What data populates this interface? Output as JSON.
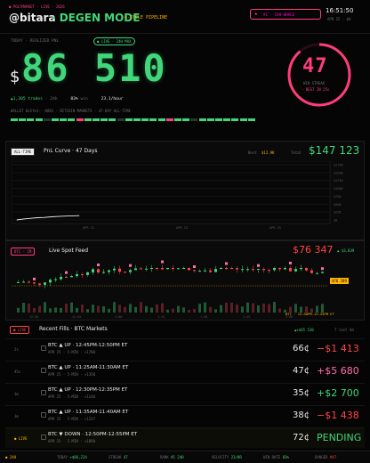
{
  "topbar": {
    "brand_tag": "● POLYMARKET · LIVE · 2026",
    "handle": "@bitara",
    "mode": "· DEGEN MODE",
    "pipeline": "6-CYCLE PIPELINE",
    "rank_badge": "#1 · 24H WHALE",
    "clock": "16:51:50",
    "date": "APR 25 · 04"
  },
  "hero": {
    "label": "TODAY · REALIZED PNL",
    "live_badge": "● LIVE · 24H MAX",
    "currency": "$",
    "amount": "86 510",
    "trades": "▲1,305 trades",
    "window": "24h",
    "win_rate": "83%",
    "win_label": "win",
    "rate": "23.1/hour",
    "wallet": "WALLET  0x5fe1···0881 · BITCOIN MARKETS · 47-DAY ALL-TIME",
    "streak_num": "47",
    "streak_label": "WIN STREAK",
    "streak_sub": "· BEST IN 25s"
  },
  "pnl_curve": {
    "tab": "ALL-TIME",
    "title": "PnL Curve · 47 Days",
    "best_label": "Best",
    "best_value": "$12.9K",
    "total_label": "Total",
    "total_value": "$147 123",
    "y_ticks": [
      "$175K",
      "$150K",
      "$125K",
      "$100K",
      "$75K",
      "$50K",
      "$25K",
      "$0"
    ],
    "x_ticks": [
      "APR 22",
      "APR 23",
      "APR 25"
    ]
  },
  "chart_data": {
    "type": "line",
    "title": "PnL Curve · 47 Days",
    "x": [
      0,
      1,
      2,
      3,
      4,
      5,
      6,
      7,
      8,
      9
    ],
    "values": [
      0,
      3,
      5,
      7,
      8,
      10,
      11,
      12,
      13,
      13.5
    ],
    "ylim": [
      0,
      175
    ]
  },
  "spot": {
    "tab": "BTC · 1M",
    "title": "Live Spot Feed",
    "price": "$76 347",
    "delta": "▲ $3,839",
    "last_tag": "$76 289",
    "x_ticks": [
      "12:30",
      "12:45",
      "1:00",
      "1:15",
      "1:30",
      "1:45",
      "2:00"
    ],
    "window_label": "BTC · 12:50PM-12:55PM ET",
    "y_ticks": [
      "$76.4K",
      "$76.3K",
      "$76.2K",
      "$76.1K",
      "$76.0K"
    ]
  },
  "fills": {
    "tab": "● LIVE",
    "title": "Recent Fills · BTC Markets",
    "summary": "▲+$45 510",
    "summary2": "7 last 4d",
    "rows": [
      {
        "age": "2s",
        "title": "BTC ▲ UP · 12:45PM-12:50PM ET",
        "sub": "APR 25 · 5-MIN · ×1700",
        "price": "66¢",
        "pnl": "−$1 413",
        "color": "red",
        "live": false
      },
      {
        "age": "45s",
        "title": "BTC ▲ UP · 11:25AM-11:30AM ET",
        "sub": "APR 25 · 5-MIN · ×1350",
        "price": "47¢",
        "pnl": "+$5 680",
        "color": "pink",
        "live": false
      },
      {
        "age": "1m",
        "title": "BTC ▲ UP · 12:30PM-12:35PM ET",
        "sub": "APR 25 · 5-MIN · ×1240",
        "price": "35¢",
        "pnl": "+$2 700",
        "color": "green",
        "live": false
      },
      {
        "age": "1m",
        "title": "BTC ▲ UP · 11:35AM-11:40AM ET",
        "sub": "APR 25 · 5-MIN · ×1237",
        "price": "38¢",
        "pnl": "−$1 438",
        "color": "red",
        "live": false
      },
      {
        "age": "● LIVE",
        "title": "BTC ▼ DOWN · 12:50PM-12:55PM ET",
        "sub": "APR 25 · 5-MIN · ×1890",
        "price": "72¢",
        "pnl": "PENDING",
        "color": "green",
        "live": true
      }
    ]
  },
  "footer": {
    "items": [
      {
        "k": "● 24H",
        "v": ""
      },
      {
        "k": "TODAY",
        "v": "+$86,224"
      },
      {
        "k": "STREAK",
        "v": "47"
      },
      {
        "k": "RANK",
        "v": "#1 24H"
      },
      {
        "k": "VELOCITY",
        "v": "23/HR"
      },
      {
        "k": "WIN RATE",
        "v": "83%"
      },
      {
        "k": "DANGER",
        "v": "#47"
      }
    ]
  },
  "colors": {
    "accent": "#ff3d7a",
    "green": "#41d67a",
    "red": "#ff4545",
    "bg": "#050505"
  }
}
